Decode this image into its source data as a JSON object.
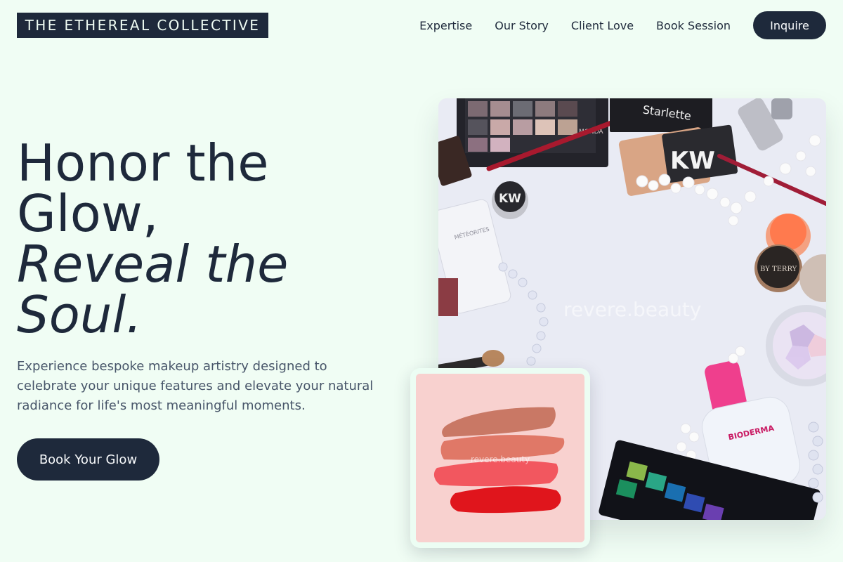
{
  "brand": {
    "name": "THE ETHEREAL COLLECTIVE"
  },
  "nav": {
    "links": [
      "Expertise",
      "Our Story",
      "Client Love",
      "Book Session"
    ],
    "cta_label": "Inquire"
  },
  "hero": {
    "title_line1": "Honor the",
    "title_line2": "Glow,",
    "title_line3": "Reveal the",
    "title_line4": "Soul.",
    "description": "Experience bespoke makeup artistry designed to celebrate your unique features and elevate your natural radiance for life's most meaningful moments.",
    "cta_label": "Book Your Glow"
  },
  "images": {
    "main_watermark": "revere.beauty",
    "swatch_watermark": "revere.beauty",
    "product_labels": {
      "palette_brand": "MONDA",
      "compact_brand": "Starlette",
      "kw_logo": "KW",
      "pot_brand": "BY TERRY",
      "bottle_brand": "BIODERMA",
      "foundation_brand": "MÉTÉORITES"
    }
  },
  "colors": {
    "background": "#f0fdf4",
    "primary": "#1e293b",
    "muted_text": "#475569",
    "swatch_bg": "#f8d1cf"
  }
}
